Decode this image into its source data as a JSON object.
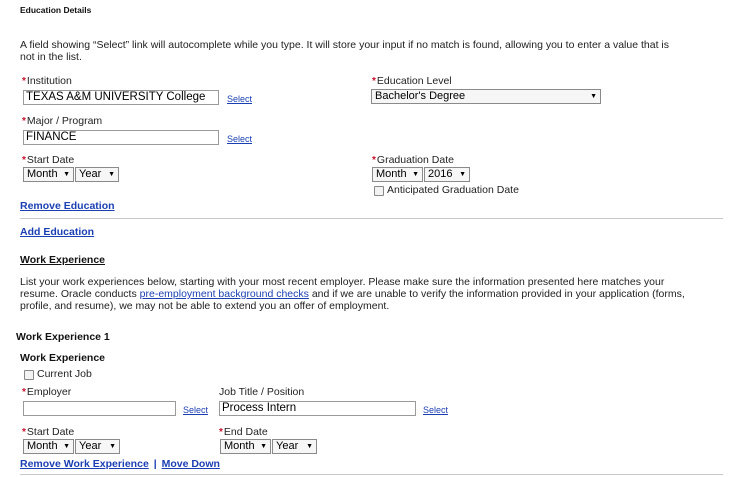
{
  "education": {
    "section_title": "Education Details",
    "intro_line1": "A field showing “Select” link will autocomplete while you type. It will store your input if no match is found, allowing you to enter a value that is",
    "intro_line2": "not in the list.",
    "institution_label": "Institution",
    "institution_value": "TEXAS A&M UNIVERSITY College",
    "education_level_label": "Education Level",
    "education_level_value": "Bachelor's Degree",
    "major_label": "Major / Program",
    "major_value": "FINANCE",
    "select_link": "Select",
    "start_date_label": "Start Date",
    "start_month": "Month",
    "start_year": "Year",
    "graduation_date_label": "Graduation Date",
    "grad_month": "Month",
    "grad_year": "2016",
    "anticipated_label": "Anticipated Graduation Date",
    "remove_link": "Remove Education",
    "add_link": "Add Education"
  },
  "work": {
    "section_title": "Work Experience",
    "intro_line1": "List your work experiences below, starting with your most recent employer. Please make sure the information presented here matches your",
    "intro_line2_pre": "resume. Oracle conducts ",
    "intro_line2_link": "pre-employment background checks",
    "intro_line2_post": " and if we are unable to verify the information provided in your application (forms,",
    "intro_line3": "profile, and resume), we may not be able to extend you an offer of employment.",
    "entry_title": "Work Experience 1",
    "entry_subtitle": "Work Experience",
    "current_job_label": "Current Job",
    "employer_label": "Employer",
    "employer_value": "",
    "job_title_label": "Job Title / Position",
    "job_title_value": "Process Intern",
    "select_link": "Select",
    "start_date_label": "Start Date",
    "start_month": "Month",
    "start_year": "Year",
    "end_date_label": "End Date",
    "end_month": "Month",
    "end_year": "Year",
    "remove_link": "Remove Work Experience",
    "separator": "|",
    "move_down_link": "Move Down"
  }
}
